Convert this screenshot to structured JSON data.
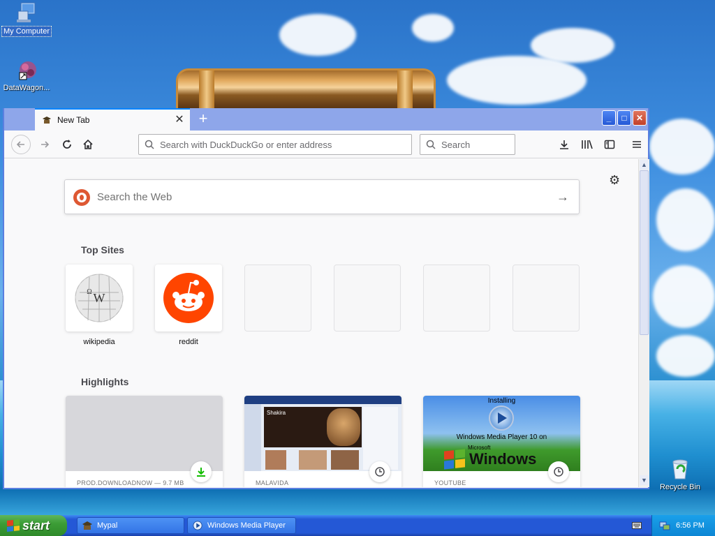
{
  "desktop": {
    "icons": [
      {
        "label": "My Computer",
        "icon": "my-computer-icon"
      },
      {
        "label": "DataWagon...",
        "icon": "datawagon-icon"
      },
      {
        "label": "Recycle Bin",
        "icon": "recycle-bin-icon"
      }
    ]
  },
  "browser": {
    "tab_title": "New Tab",
    "urlbar_placeholder": "Search with DuckDuckGo or enter address",
    "searchbar_placeholder": "Search",
    "web_search_placeholder": "Search the Web",
    "top_sites_title": "Top Sites",
    "top_sites": [
      {
        "label": "wikipedia",
        "icon": "wikipedia-icon"
      },
      {
        "label": "reddit",
        "icon": "reddit-icon"
      },
      {
        "label": ""
      },
      {
        "label": ""
      },
      {
        "label": ""
      },
      {
        "label": ""
      }
    ],
    "highlights_title": "Highlights",
    "highlights": [
      {
        "source": "PROD.DOWNLOADNOW — 9.7 MB",
        "badge": "download-icon"
      },
      {
        "source": "MALAVIDA",
        "badge": "clock-icon",
        "thumb_text": "Shakira"
      },
      {
        "source": "YOUTUBE",
        "badge": "clock-icon",
        "thumb_text_1": "Installing",
        "thumb_text_2": "Windows Media Player 10 on",
        "thumb_text_3": "Microsoft",
        "thumb_text_4": "Windows"
      }
    ]
  },
  "taskbar": {
    "start_label": "start",
    "tasks": [
      {
        "label": "Mypal",
        "icon": "mypal-icon"
      },
      {
        "label": "Windows Media Player",
        "icon": "media-player-icon"
      }
    ],
    "clock": "6:56 PM"
  },
  "colors": {
    "accent": "#0a84ff",
    "titlebar": "#8ea6ea",
    "reddit": "#ff4500",
    "duckduckgo": "#de5833",
    "download_green": "#12bc00"
  }
}
